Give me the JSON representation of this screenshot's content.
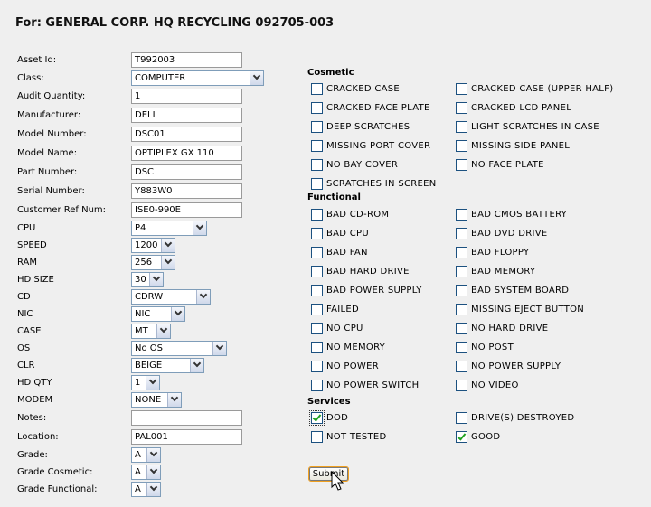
{
  "title": "For: GENERAL CORP. HQ RECYCLING 092705-003",
  "fields": {
    "asset_id": {
      "label": "Asset Id:",
      "value": "T992003"
    },
    "class": {
      "label": "Class:",
      "value": "COMPUTER"
    },
    "audit_qty": {
      "label": "Audit Quantity:",
      "value": "1"
    },
    "manufacturer": {
      "label": "Manufacturer:",
      "value": "DELL"
    },
    "model_number": {
      "label": "Model Number:",
      "value": "DSC01"
    },
    "model_name": {
      "label": "Model Name:",
      "value": "OPTIPLEX GX 110"
    },
    "part_number": {
      "label": "Part Number:",
      "value": "DSC"
    },
    "serial_number": {
      "label": "Serial Number:",
      "value": "Y883W0"
    },
    "customer_ref": {
      "label": "Customer Ref Num:",
      "value": "ISE0-990E"
    },
    "cpu": {
      "label": "CPU",
      "value": "P4"
    },
    "speed": {
      "label": "SPEED",
      "value": "1200"
    },
    "ram": {
      "label": "RAM",
      "value": "256"
    },
    "hd_size": {
      "label": "HD SIZE",
      "value": "30"
    },
    "cd": {
      "label": "CD",
      "value": "CDRW"
    },
    "nic": {
      "label": "NIC",
      "value": "NIC"
    },
    "case": {
      "label": "CASE",
      "value": "MT"
    },
    "os": {
      "label": "OS",
      "value": "No OS"
    },
    "clr": {
      "label": "CLR",
      "value": "BEIGE"
    },
    "hd_qty": {
      "label": "HD QTY",
      "value": "1"
    },
    "modem": {
      "label": "MODEM",
      "value": "NONE"
    },
    "notes": {
      "label": "Notes:",
      "value": ""
    },
    "location": {
      "label": "Location:",
      "value": "PAL001"
    },
    "grade": {
      "label": "Grade:",
      "value": "A"
    },
    "grade_cosmetic": {
      "label": "Grade Cosmetic:",
      "value": "A"
    },
    "grade_functional": {
      "label": "Grade Functional:",
      "value": "A"
    }
  },
  "sections": {
    "cosmetic": "Cosmetic",
    "functional": "Functional",
    "services": "Services"
  },
  "cosmetic": [
    {
      "label": "CRACKED CASE",
      "checked": false
    },
    {
      "label": "CRACKED CASE (UPPER HALF)",
      "checked": false
    },
    {
      "label": "CRACKED FACE PLATE",
      "checked": false
    },
    {
      "label": "CRACKED LCD PANEL",
      "checked": false
    },
    {
      "label": "DEEP SCRATCHES",
      "checked": false
    },
    {
      "label": "LIGHT SCRATCHES IN CASE",
      "checked": false
    },
    {
      "label": "MISSING PORT COVER",
      "checked": false
    },
    {
      "label": "MISSING SIDE PANEL",
      "checked": false
    },
    {
      "label": "NO BAY COVER",
      "checked": false
    },
    {
      "label": "NO FACE PLATE",
      "checked": false
    },
    {
      "label": "SCRATCHES IN SCREEN",
      "checked": false
    }
  ],
  "functional": [
    {
      "label": "BAD CD-ROM",
      "checked": false
    },
    {
      "label": "BAD CMOS BATTERY",
      "checked": false
    },
    {
      "label": "BAD CPU",
      "checked": false
    },
    {
      "label": "BAD DVD DRIVE",
      "checked": false
    },
    {
      "label": "BAD FAN",
      "checked": false
    },
    {
      "label": "BAD FLOPPY",
      "checked": false
    },
    {
      "label": "BAD HARD DRIVE",
      "checked": false
    },
    {
      "label": "BAD MEMORY",
      "checked": false
    },
    {
      "label": "BAD POWER SUPPLY",
      "checked": false
    },
    {
      "label": "BAD SYSTEM BOARD",
      "checked": false
    },
    {
      "label": "FAILED",
      "checked": false
    },
    {
      "label": "MISSING EJECT BUTTON",
      "checked": false
    },
    {
      "label": "NO CPU",
      "checked": false
    },
    {
      "label": "NO HARD DRIVE",
      "checked": false
    },
    {
      "label": "NO MEMORY",
      "checked": false
    },
    {
      "label": "NO POST",
      "checked": false
    },
    {
      "label": "NO POWER",
      "checked": false
    },
    {
      "label": "NO POWER SUPPLY",
      "checked": false
    },
    {
      "label": "NO POWER SWITCH",
      "checked": false
    },
    {
      "label": "NO VIDEO",
      "checked": false
    }
  ],
  "services": [
    {
      "label": "DOD",
      "checked": true
    },
    {
      "label": "DRIVE(S) DESTROYED",
      "checked": false
    },
    {
      "label": "NOT TESTED",
      "checked": false
    },
    {
      "label": "GOOD",
      "checked": true
    }
  ],
  "submit_label": "Submit"
}
